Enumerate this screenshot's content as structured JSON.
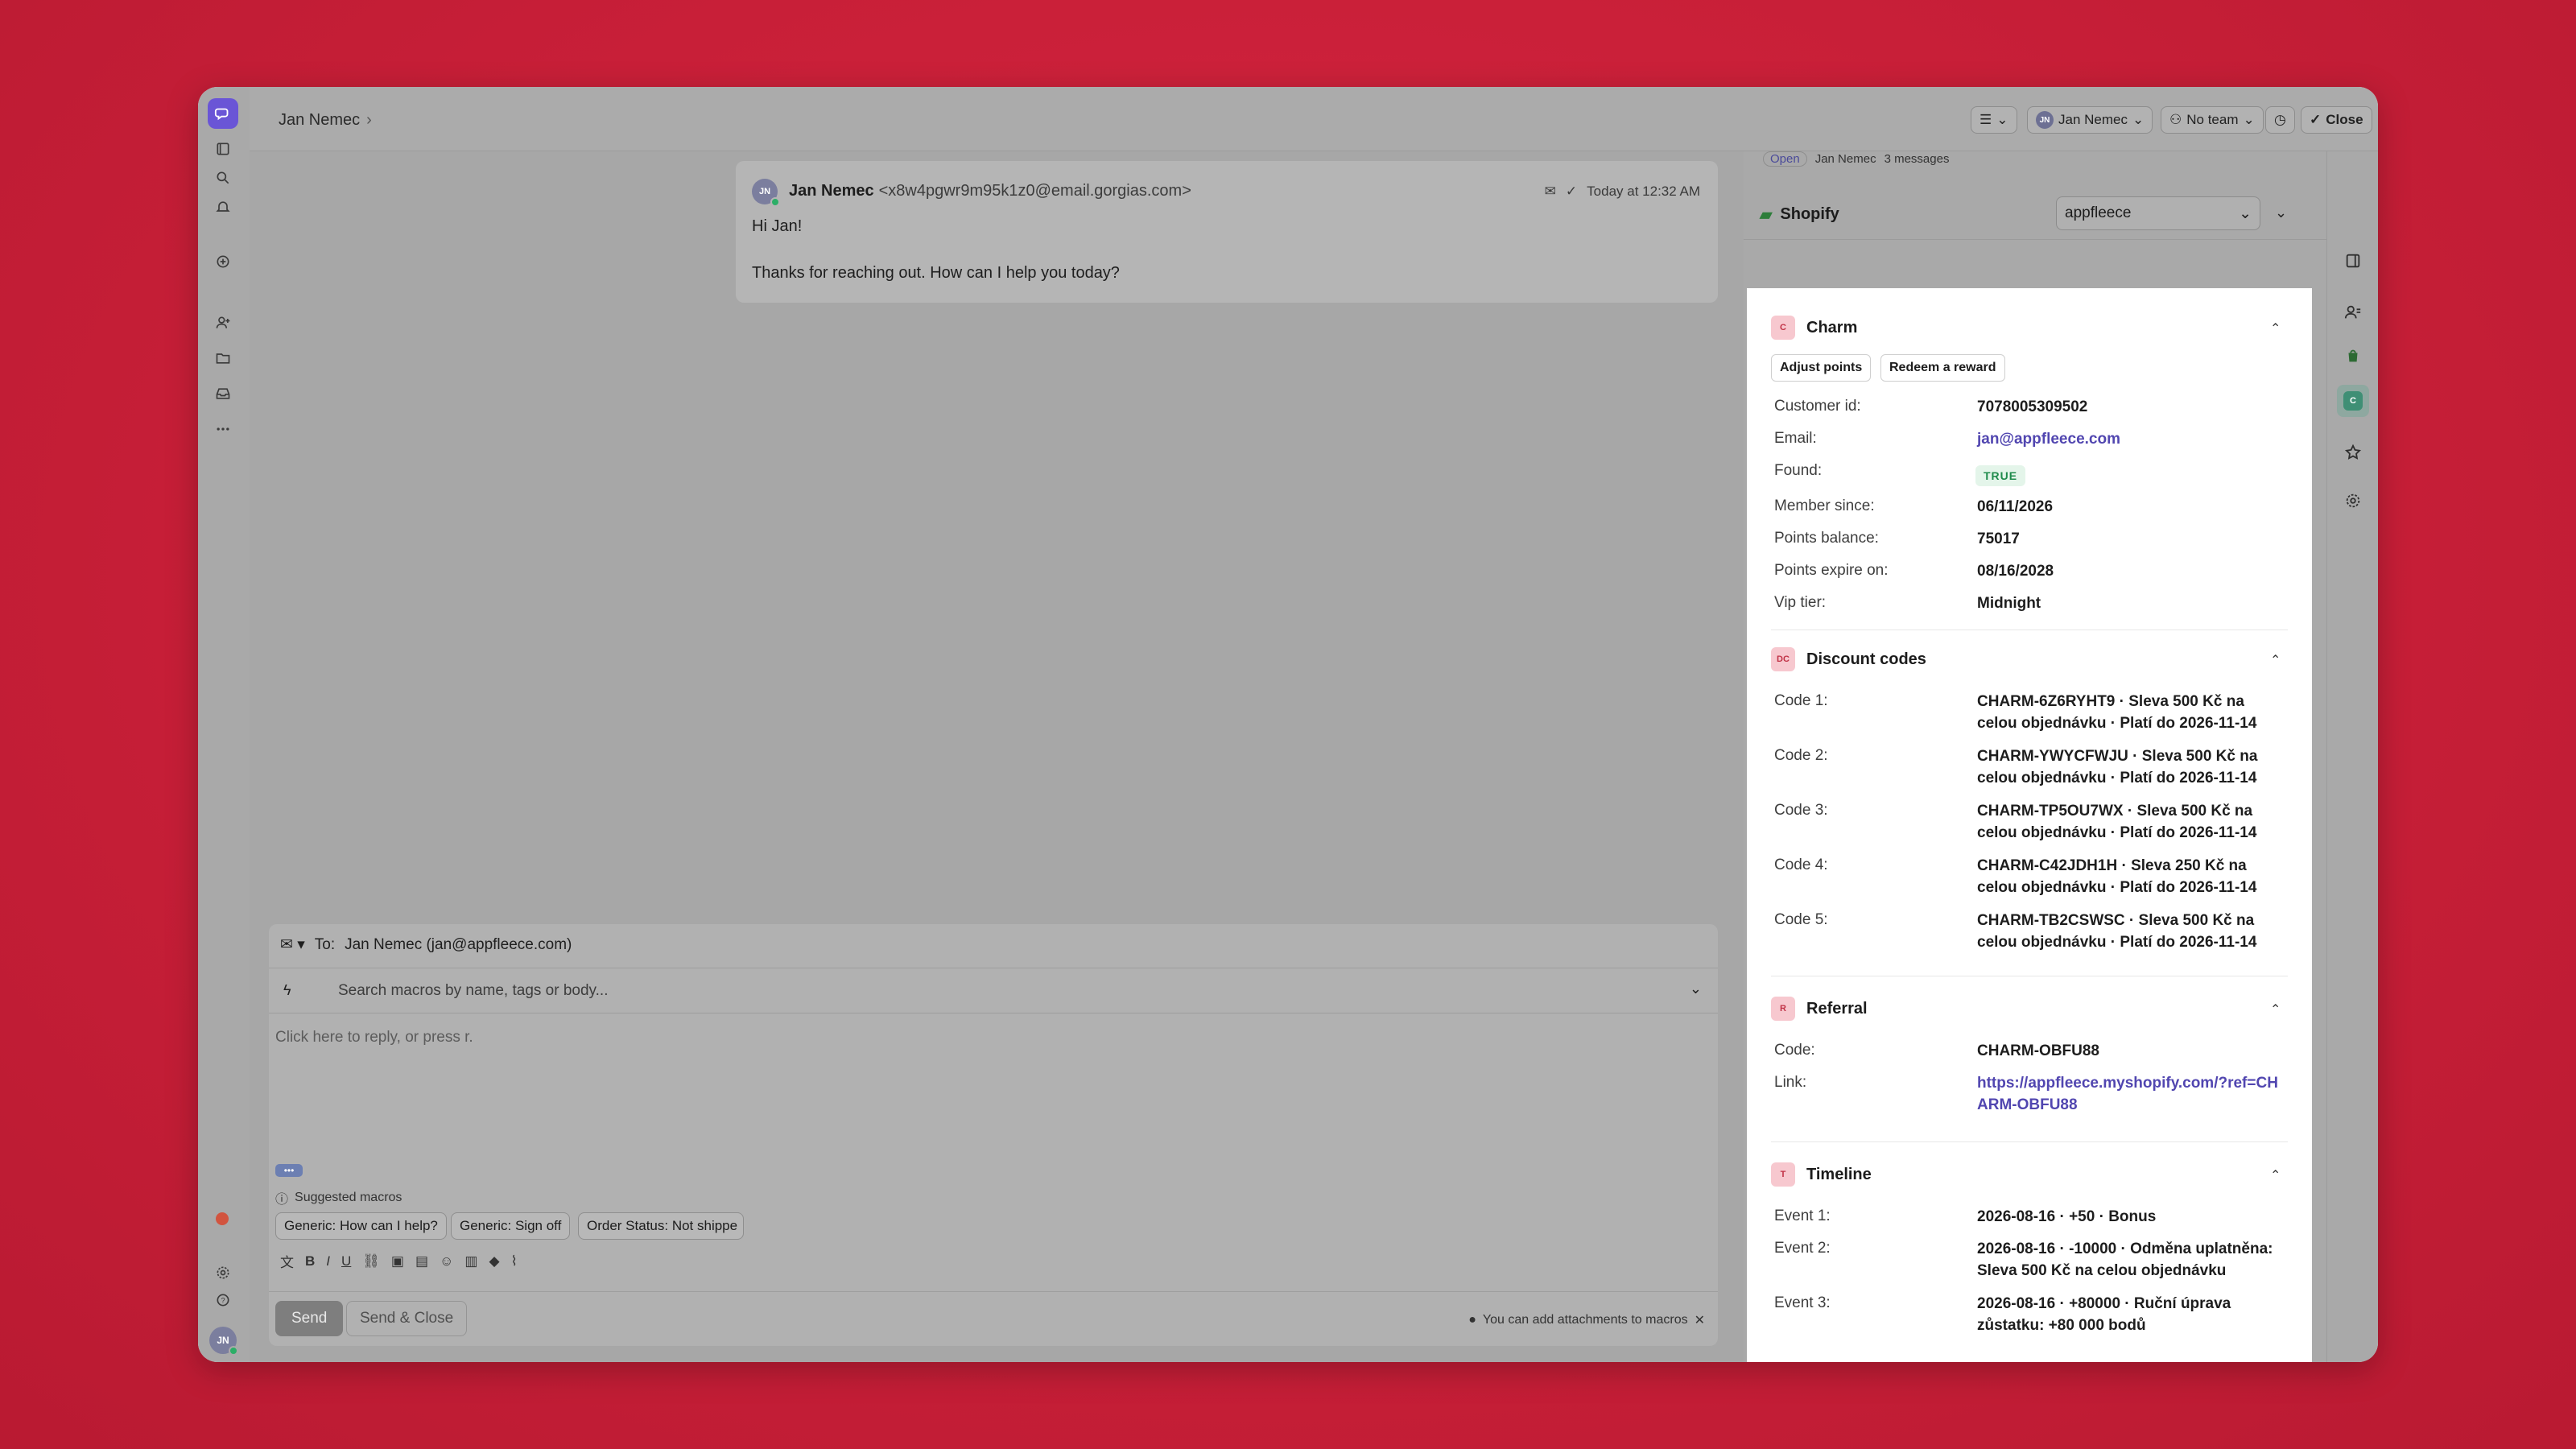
{
  "topbar": {
    "breadcrumb": "Jan Nemec",
    "assignee": "Jan Nemec",
    "assignee_initials": "JN",
    "team": "No team",
    "close_label": "Close"
  },
  "message": {
    "sender_initials": "JN",
    "sender_name": "Jan Nemec",
    "sender_email": "<x8w4pgwr9m95k1z0@email.gorgias.com>",
    "time": "Today at 12:32 AM",
    "line1": "Hi Jan!",
    "line2": "Thanks for reaching out. How can I help you today?"
  },
  "reply": {
    "to_label": "To:",
    "to_value": "Jan Nemec (jan@appfleece.com)",
    "macro_placeholder": "Search macros by name, tags or body...",
    "body_placeholder": "Click here to reply, or press r.",
    "dots": "•••",
    "suggested_label": "Suggested macros",
    "suggested": [
      "Generic: How can I help?",
      "Generic: Sign off",
      "Order Status: Not shippe"
    ],
    "send_label": "Send",
    "send_close_label": "Send & Close",
    "attach_hint": "You can add attachments to macros"
  },
  "panel": {
    "ticket_status": "Open",
    "ticket_owner": "Jan Nemec",
    "ticket_messages": "3 messages",
    "shopify_label": "Shopify",
    "store": "appfleece",
    "charm": {
      "badge": "C",
      "title": "Charm",
      "adjust_points": "Adjust points",
      "redeem_reward": "Redeem a reward",
      "fields": [
        {
          "label": "Customer id:",
          "value": "7078005309502"
        },
        {
          "label": "Email:",
          "value": "jan@appfleece.com"
        },
        {
          "label": "Found:",
          "value": "TRUE"
        },
        {
          "label": "Member since:",
          "value": "06/11/2026"
        },
        {
          "label": "Points balance:",
          "value": "75017"
        },
        {
          "label": "Points expire on:",
          "value": "08/16/2028"
        },
        {
          "label": "Vip tier:",
          "value": "Midnight"
        }
      ]
    },
    "discounts": {
      "badge": "DC",
      "title": "Discount codes",
      "codes": [
        {
          "label": "Code 1:",
          "value": "CHARM-6Z6RYHT9 · Sleva 500 Kč na celou objednávku · Platí do 2026-11-14"
        },
        {
          "label": "Code 2:",
          "value": "CHARM-YWYCFWJU · Sleva 500 Kč na celou objednávku · Platí do 2026-11-14"
        },
        {
          "label": "Code 3:",
          "value": "CHARM-TP5OU7WX · Sleva 500 Kč na celou objednávku · Platí do 2026-11-14"
        },
        {
          "label": "Code 4:",
          "value": "CHARM-C42JDH1H · Sleva 250 Kč na celou objednávku · Platí do 2026-11-14"
        },
        {
          "label": "Code 5:",
          "value": "CHARM-TB2CSWSC · Sleva 500 Kč na celou objednávku · Platí do 2026-11-14"
        }
      ]
    },
    "referral": {
      "badge": "R",
      "title": "Referral",
      "code_label": "Code:",
      "code_value": "CHARM-OBFU88",
      "link_label": "Link:",
      "link_value": "https://appfleece.myshopify.com/?ref=CHARM-OBFU88"
    },
    "timeline": {
      "badge": "T",
      "title": "Timeline",
      "events": [
        {
          "label": "Event 1:",
          "value": "2026-08-16 · +50 · Bonus"
        },
        {
          "label": "Event 2:",
          "value": "2026-08-16 · -10000 · Odměna uplatněna: Sleva 500 Kč na celou objednávku"
        },
        {
          "label": "Event 3:",
          "value": "2026-08-16 · +80000 · Ruční úprava zůstatku: +80 000 bodů"
        }
      ]
    }
  },
  "rail": {
    "user_initials": "JN"
  }
}
